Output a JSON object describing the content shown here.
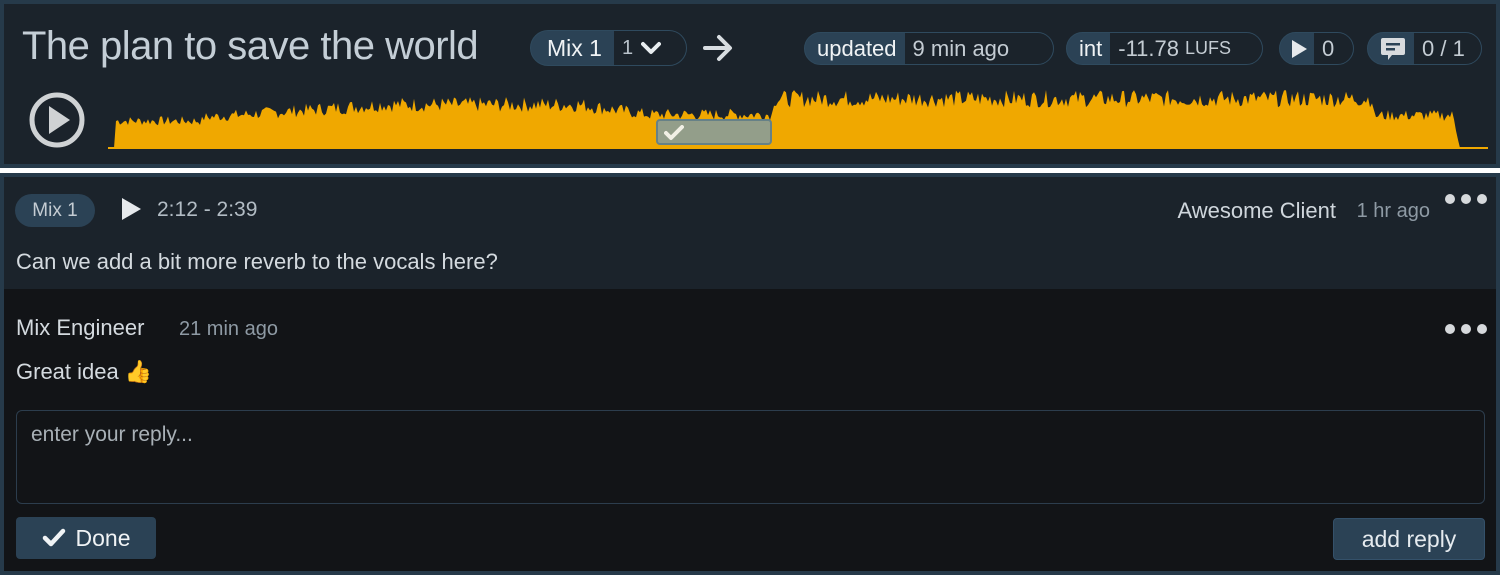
{
  "header": {
    "title": "The plan to save the world",
    "mix_name": "Mix 1",
    "mix_version": "1",
    "updated_label": "updated",
    "updated_value": "9 min ago",
    "loudness_label": "int",
    "loudness_value": "-11.78",
    "loudness_unit": "LUFS",
    "plays_count": "0",
    "comments_count": "0 / 1"
  },
  "player": {
    "waveform_color": "#f0a800",
    "comment_region": {
      "start": "2:12",
      "end": "2:39",
      "resolved": true
    }
  },
  "comment": {
    "mix_tag": "Mix 1",
    "time_range": "2:12 - 2:39",
    "author": "Awesome Client",
    "ago": "1 hr ago",
    "text": "Can we add a bit more reverb to the vocals here?"
  },
  "reply": {
    "author": "Mix Engineer",
    "ago": "21 min ago",
    "text": "Great idea",
    "emoji": "👍"
  },
  "reply_form": {
    "placeholder": "enter your reply...",
    "value": "",
    "done_label": "Done",
    "add_reply_label": "add reply"
  },
  "colors": {
    "accent": "#2b4255",
    "waveform": "#f0a800",
    "panel": "#1b232b",
    "reply_bg": "#121417"
  }
}
